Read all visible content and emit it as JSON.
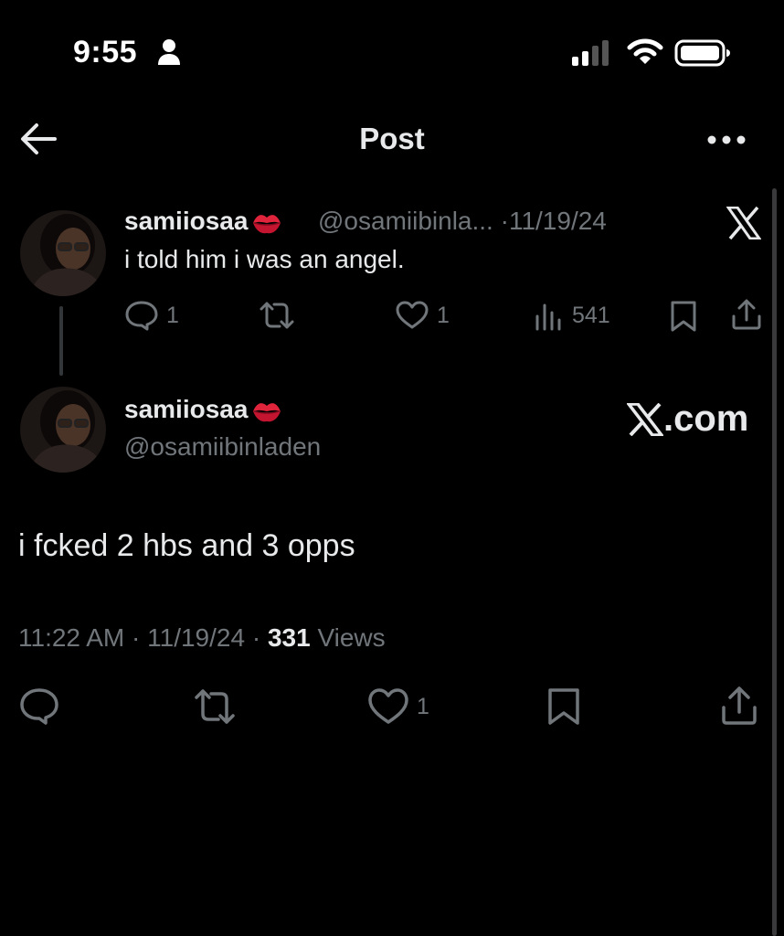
{
  "status_bar": {
    "time": "9:55"
  },
  "header": {
    "title": "Post"
  },
  "quoted_post": {
    "display_name": "samiiosaa",
    "handle": "@osamiibinla...",
    "separator": "·",
    "date": "11/19/24",
    "text": "i told him i was an angel.",
    "replies": "1",
    "likes": "1",
    "views": "541"
  },
  "main_post": {
    "display_name": "samiiosaa",
    "handle": "@osamiibinladen",
    "source_badge": ".com",
    "text": "i fcked 2 hbs and 3 opps",
    "time": "11:22 AM",
    "separator": "·",
    "date": "11/19/24",
    "views_count": "331",
    "views_label": "Views",
    "likes": "1"
  },
  "colors": {
    "background": "#000000",
    "text": "#e7e9ea",
    "muted": "#71767b"
  }
}
